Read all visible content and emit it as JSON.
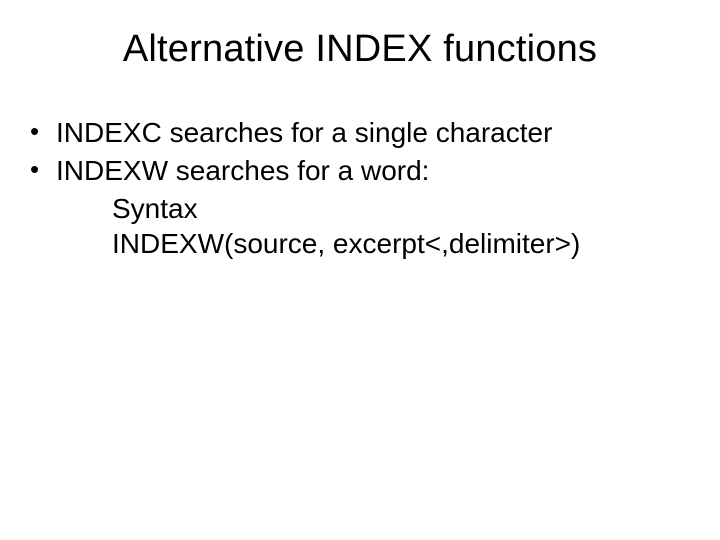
{
  "title": "Alternative INDEX functions",
  "bullets": [
    "INDEXC searches for a single character",
    "INDEXW searches for a word:"
  ],
  "sublines": [
    "Syntax",
    "INDEXW(source, excerpt<,delimiter>)"
  ]
}
